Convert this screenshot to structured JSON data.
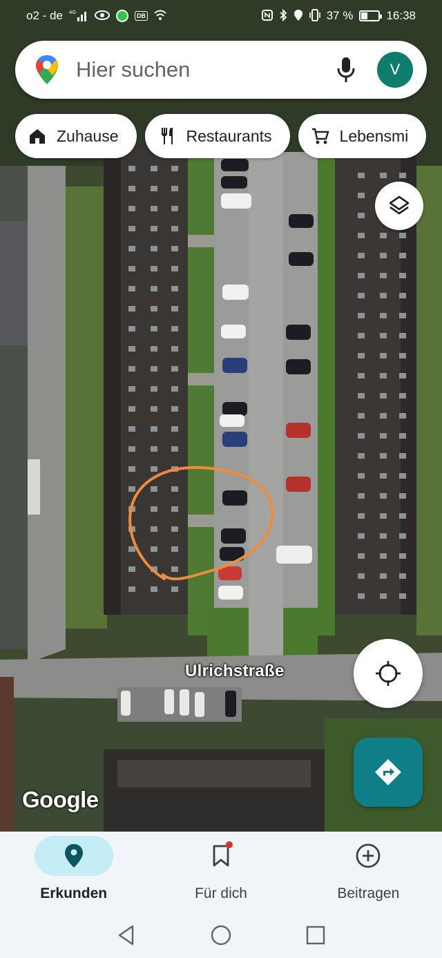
{
  "status_bar": {
    "carrier": "o2 - de",
    "network": "4G",
    "battery_text": "37 %",
    "battery_level": 0.37,
    "time": "16:38"
  },
  "search": {
    "placeholder": "Hier suchen",
    "avatar_letter": "V"
  },
  "chips": [
    {
      "label": "Zuhause",
      "icon": "home-icon"
    },
    {
      "label": "Restaurants",
      "icon": "restaurant-icon"
    },
    {
      "label": "Lebensmi",
      "icon": "cart-icon"
    }
  ],
  "map": {
    "street_label": "Ulrichstraße",
    "logo": "Google",
    "annotation_color": "#f08a3c",
    "directions_color": "#0f7e86"
  },
  "bottom_nav": [
    {
      "label": "Erkunden",
      "icon": "explore-pin-icon",
      "active": true
    },
    {
      "label": "Für dich",
      "icon": "bookmark-icon",
      "active": false,
      "badge": true
    },
    {
      "label": "Beitragen",
      "icon": "add-circle-icon",
      "active": false
    }
  ],
  "colors": {
    "accent": "#0f7e86",
    "avatar": "#0e7d6b",
    "active_tab_bg": "#c6ecf5"
  }
}
